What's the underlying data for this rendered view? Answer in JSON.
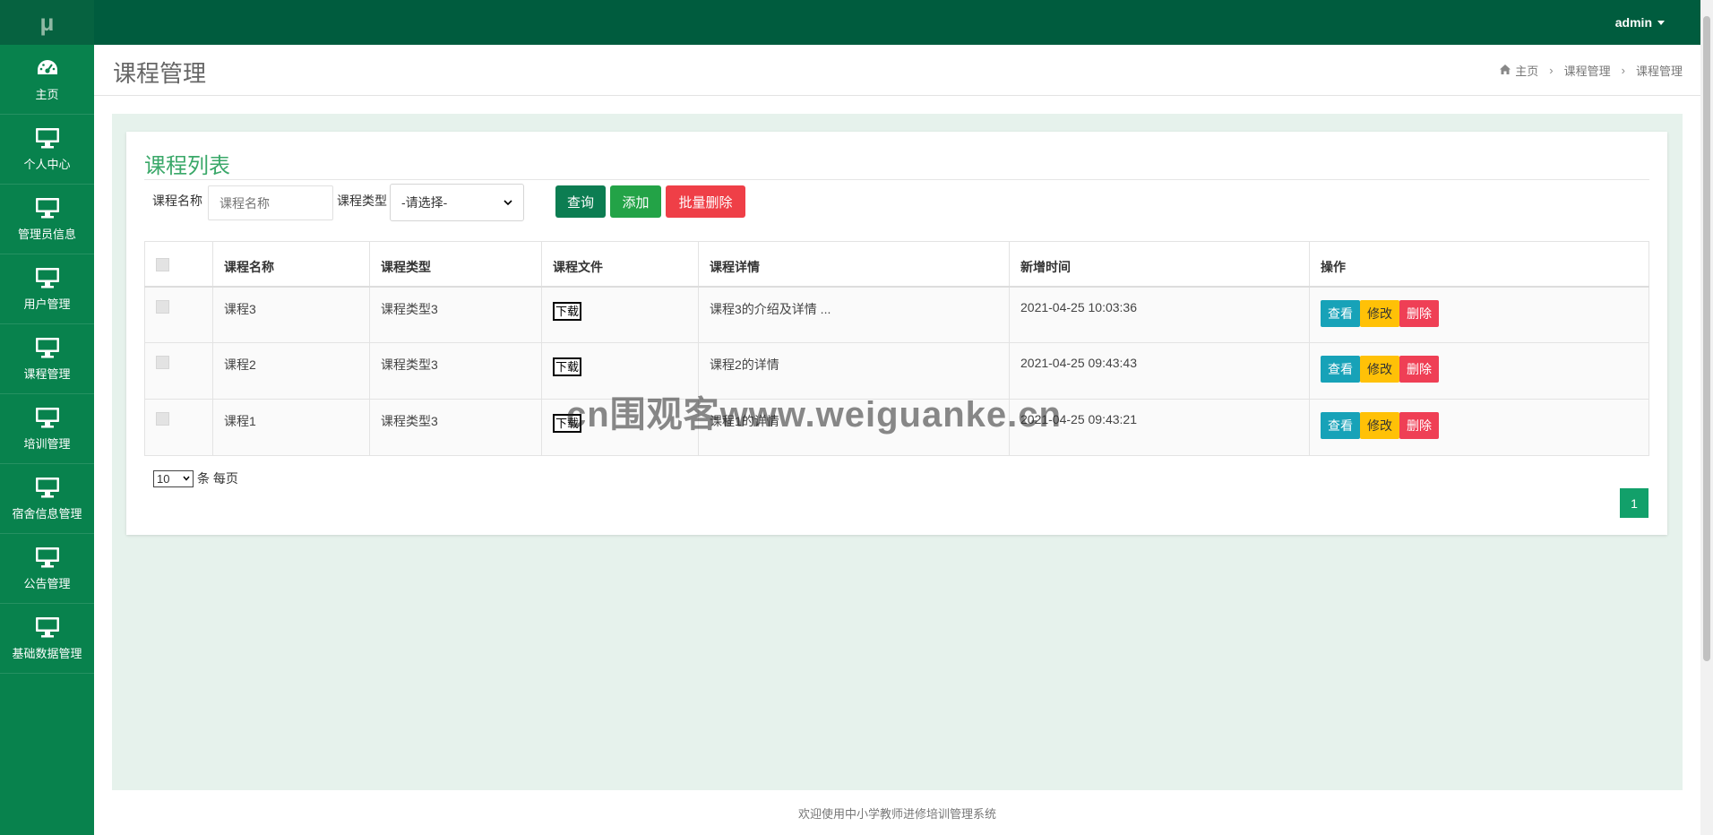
{
  "logo": "μ",
  "sidebar": {
    "items": [
      {
        "label": "主页",
        "icon": "dashboard-icon"
      },
      {
        "label": "个人中心",
        "icon": "monitor-icon"
      },
      {
        "label": "管理员信息",
        "icon": "monitor-icon"
      },
      {
        "label": "用户管理",
        "icon": "monitor-icon"
      },
      {
        "label": "课程管理",
        "icon": "monitor-icon"
      },
      {
        "label": "培训管理",
        "icon": "monitor-icon"
      },
      {
        "label": "宿舍信息管理",
        "icon": "monitor-icon"
      },
      {
        "label": "公告管理",
        "icon": "monitor-icon"
      },
      {
        "label": "基础数据管理",
        "icon": "monitor-icon"
      }
    ]
  },
  "topbar": {
    "user": "admin"
  },
  "header": {
    "title": "课程管理",
    "breadcrumb": [
      "主页",
      "课程管理",
      "课程管理"
    ]
  },
  "panel": {
    "title": "课程列表",
    "filters": {
      "name_label": "课程名称",
      "name_placeholder": "课程名称",
      "type_label": "课程类型",
      "type_selected": "-请选择-"
    },
    "buttons": {
      "query": "查询",
      "add": "添加",
      "batch_delete": "批量删除"
    }
  },
  "table": {
    "columns": [
      "课程名称",
      "课程类型",
      "课程文件",
      "课程详情",
      "新增时间",
      "操作"
    ],
    "rows": [
      {
        "name": "课程3",
        "type": "课程类型3",
        "file": "下载",
        "detail": "课程3的介绍及详情 ...",
        "time": "2021-04-25 10:03:36"
      },
      {
        "name": "课程2",
        "type": "课程类型3",
        "file": "下载",
        "detail": "课程2的详情",
        "time": "2021-04-25 09:43:43"
      },
      {
        "name": "课程1",
        "type": "课程类型3",
        "file": "下载",
        "detail": "课程1的详情",
        "time": "2021-04-25 09:43:21"
      }
    ],
    "actions": {
      "view": "查看",
      "edit": "修改",
      "delete": "删除"
    }
  },
  "pagination": {
    "page_size": "10",
    "page_size_suffix": "条 每页",
    "current_page": "1"
  },
  "footer": "欢迎使用中小学教师进修培训管理系统",
  "watermark": "cn围观客www.weiguanke.cn",
  "colors": {
    "sidebar": "#08824d",
    "topbar": "#005c3e",
    "accent": "#3aa869"
  }
}
